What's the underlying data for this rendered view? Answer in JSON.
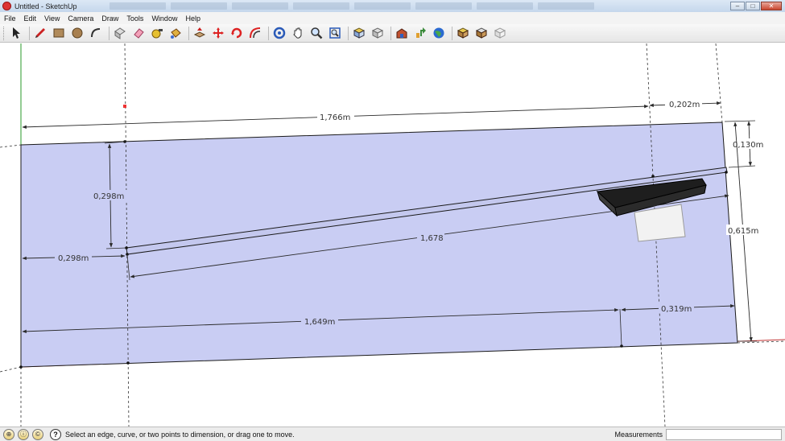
{
  "window": {
    "title": "Untitled - SketchUp",
    "controls": [
      "–",
      "□",
      "✕"
    ]
  },
  "menu": [
    "File",
    "Edit",
    "View",
    "Camera",
    "Draw",
    "Tools",
    "Window",
    "Help"
  ],
  "toolbar": {
    "tools": [
      "select-icon",
      "pencil-icon",
      "rectangle-icon",
      "circle-icon",
      "arc-icon",
      "make-component-icon",
      "eraser-icon",
      "tape-measure-icon",
      "paint-bucket-icon",
      "push-pull-icon",
      "move-icon",
      "rotate-icon",
      "offset-icon",
      "orbit-icon",
      "pan-icon",
      "zoom-icon",
      "zoom-extents-icon",
      "previous-view-icon",
      "next-view-icon",
      "3d-warehouse-icon",
      "share-model-icon",
      "google-earth-icon",
      "get-models-icon",
      "share-component-icon",
      "extension-warehouse-icon"
    ]
  },
  "dimensions": {
    "d1": "1,766m",
    "d2": "0,202m",
    "d3": "0,130m",
    "d4": "0,298m",
    "d5": "0,298m",
    "d6": "1,678",
    "d7": "0,615m",
    "d8": "1,649m",
    "d9": "0,319m"
  },
  "colors": {
    "face": "#c9cdf3",
    "edge": "#1a1a1a",
    "green_axis": "#2a9a2a",
    "red_axis": "#c03030",
    "dimension": "#2a2a2a"
  },
  "statusbar": {
    "message": "Select an edge, curve, or two points to dimension, or drag one to move.",
    "measurements_label": "Measurements",
    "measurements_value": ""
  }
}
